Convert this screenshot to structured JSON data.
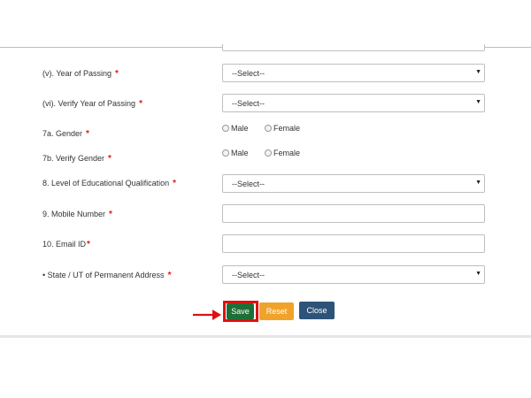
{
  "form": {
    "year_of_passing": {
      "label": "(v). Year of Passing",
      "required": "*",
      "selected": "--Select--"
    },
    "verify_year_of_passing": {
      "label": "(vi). Verify Year of Passing",
      "required": "*",
      "selected": "--Select--"
    },
    "gender": {
      "label": "7a. Gender",
      "required": "*",
      "options": [
        "Male",
        "Female"
      ]
    },
    "verify_gender": {
      "label": "7b. Verify Gender",
      "required": "*",
      "options": [
        "Male",
        "Female"
      ]
    },
    "education_level": {
      "label": "8. Level of Educational Qualification",
      "required": "*",
      "selected": "--Select--"
    },
    "mobile_number": {
      "label": "9. Mobile Number",
      "required": "*",
      "value": ""
    },
    "email_id": {
      "label": "10. Email ID",
      "required": "*",
      "value": ""
    },
    "state_ut": {
      "label": "• State / UT of Permanent Address",
      "required": "*",
      "selected": "--Select--"
    }
  },
  "buttons": {
    "save": "Save",
    "reset": "Reset",
    "close": "Close"
  },
  "icons": {
    "caret": "caret-down-icon",
    "arrow": "arrow-right-icon"
  },
  "colors": {
    "required": "#e01b1b",
    "save": "#1e6f36",
    "reset": "#f0a32a",
    "close": "#2d5478",
    "highlight": "#e01010"
  }
}
